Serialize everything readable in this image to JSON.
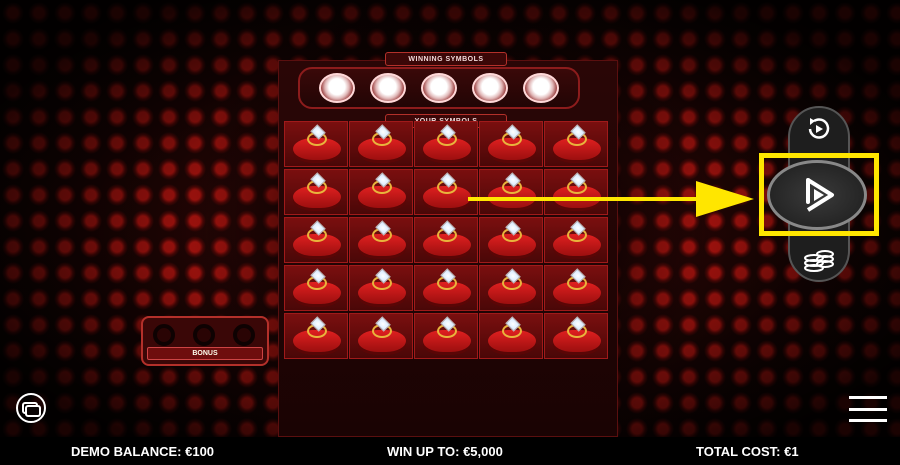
{
  "labels": {
    "winning_symbols": "WINNING SYMBOLS",
    "your_symbols": "YOUR SYMBOLS",
    "bonus": "BONUS"
  },
  "winning_symbols": [
    "diamond",
    "diamond",
    "diamond",
    "diamond",
    "diamond"
  ],
  "your_symbols": [
    [
      "ring-box",
      "ring-box",
      "ring-box",
      "ring-box",
      "ring-box"
    ],
    [
      "ring-box",
      "ring-box",
      "ring-box",
      "ring-box",
      "ring-box"
    ],
    [
      "ring-box",
      "ring-box",
      "ring-box",
      "ring-box",
      "ring-box"
    ],
    [
      "ring-box",
      "ring-box",
      "ring-box",
      "ring-box",
      "ring-box"
    ],
    [
      "ring-box",
      "ring-box",
      "ring-box",
      "ring-box",
      "ring-box"
    ]
  ],
  "controls": {
    "autoplay_icon": "autoplay-icon",
    "play_icon": "play-icon",
    "coins_icon": "coins-icon",
    "paytable_icon": "paytable-icon",
    "menu_icon": "hamburger-menu-icon"
  },
  "annotation": {
    "highlight_color": "#ffe600"
  },
  "footer": {
    "balance": "DEMO BALANCE: €100",
    "win_up_to": "WIN UP TO: €5,000",
    "total_cost": "TOTAL COST: €1"
  },
  "colors": {
    "accent": "#b3140f",
    "cell": "#7a0f0f"
  }
}
